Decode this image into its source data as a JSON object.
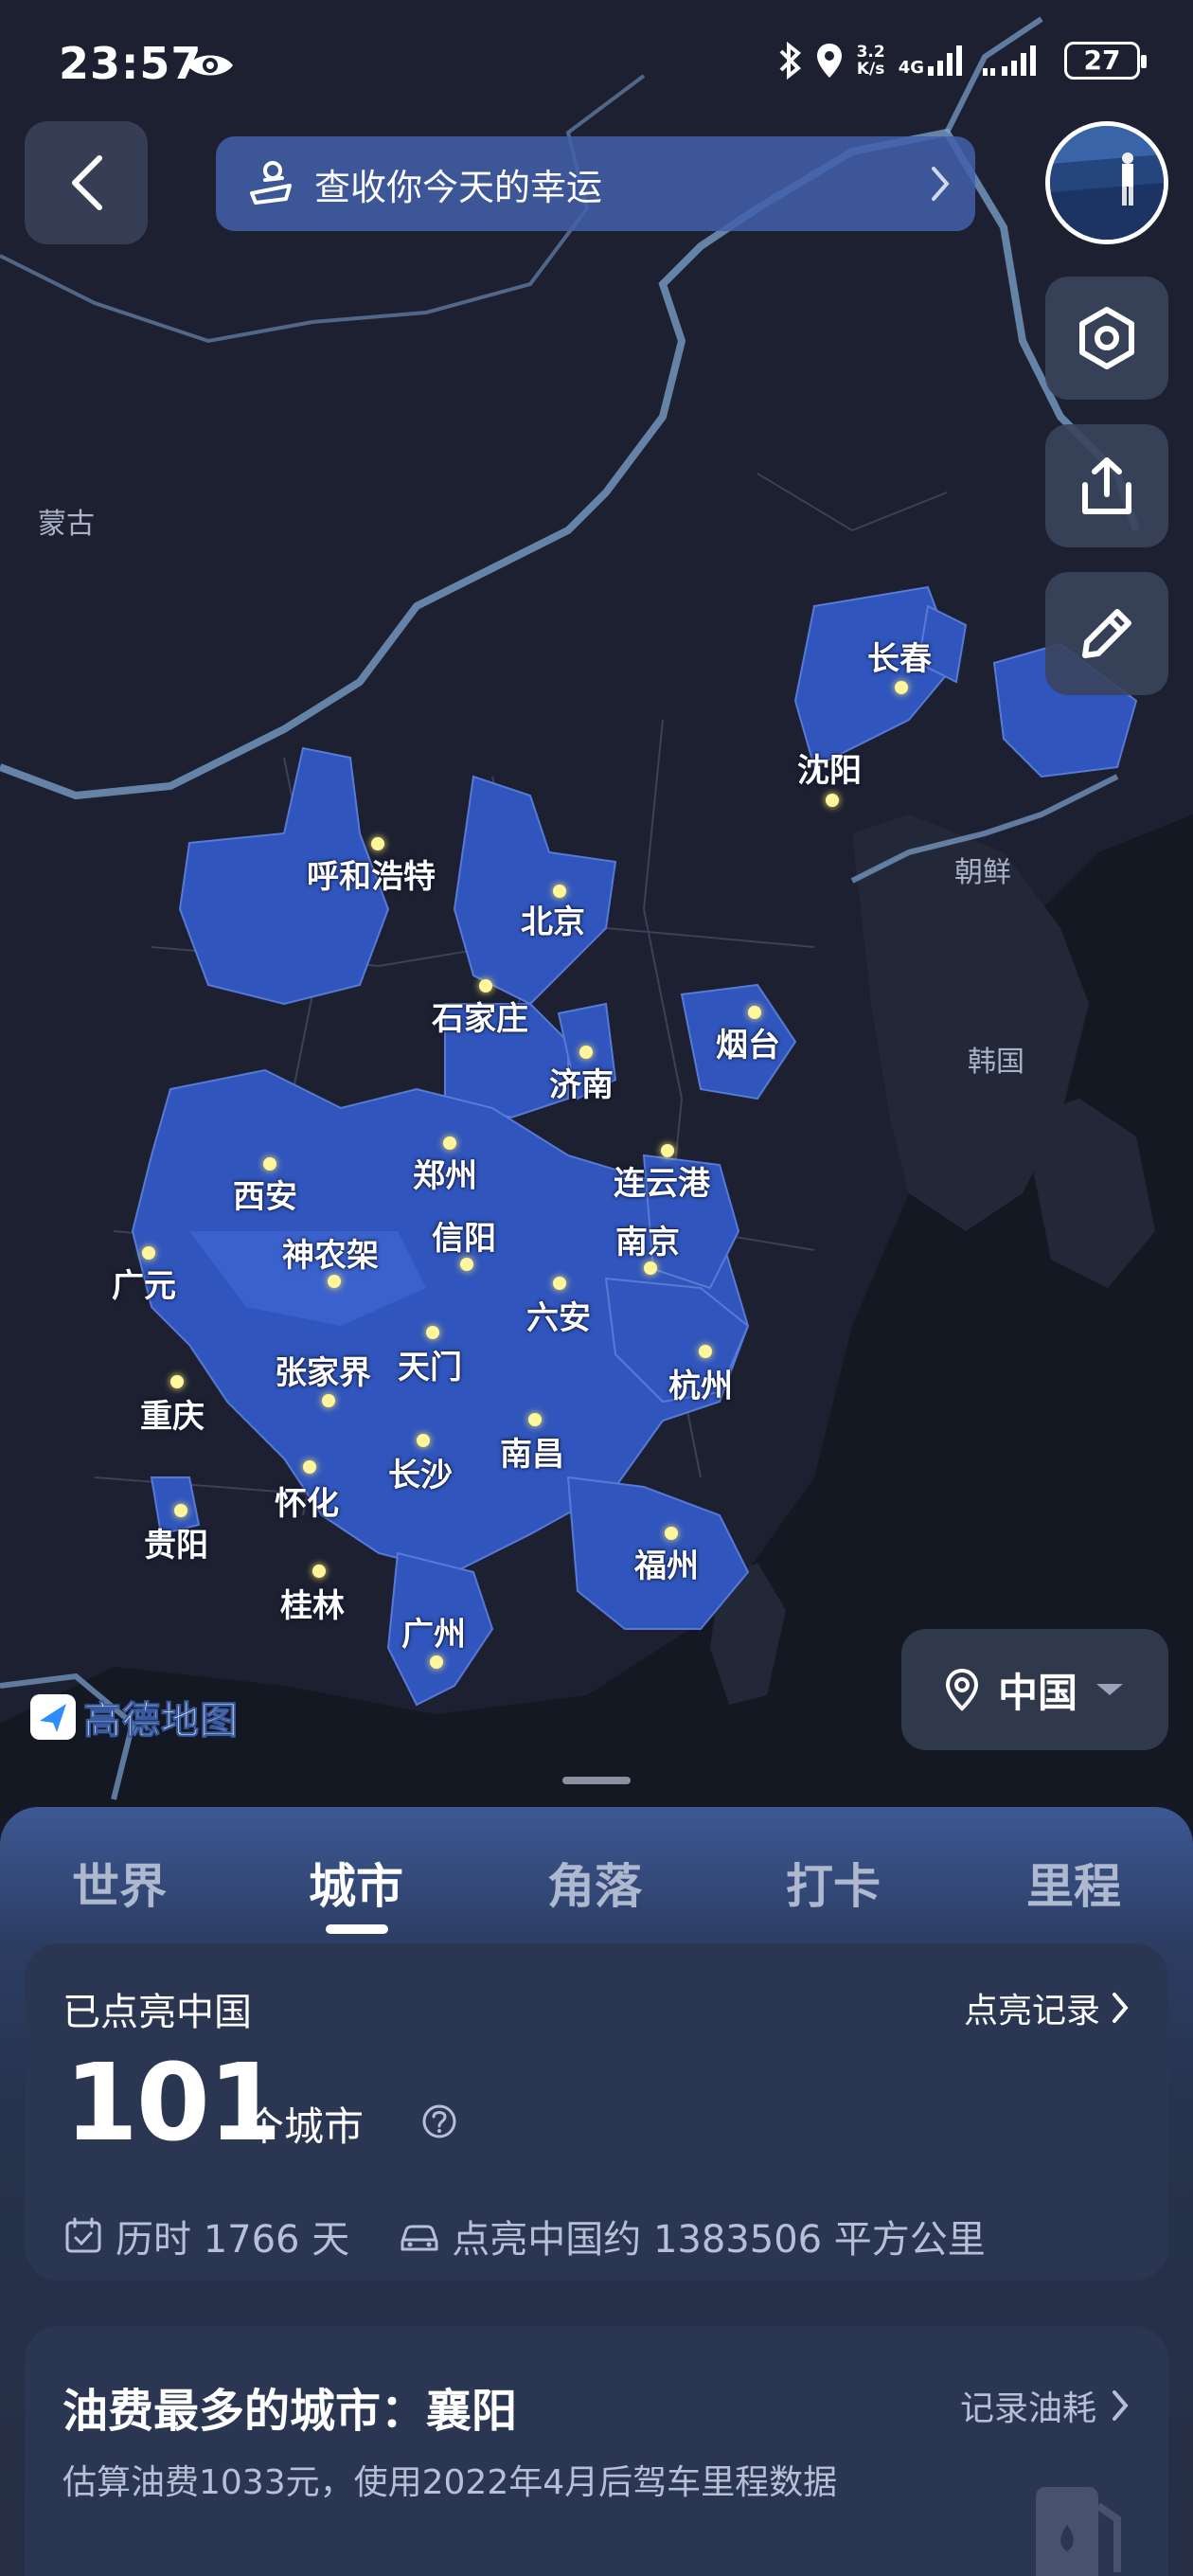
{
  "status_bar": {
    "time": "23:57",
    "speed_value": "3.2",
    "speed_unit": "K/s",
    "network": "4G",
    "battery": "27"
  },
  "header": {
    "fortune_label": "查收你今天的幸运"
  },
  "map": {
    "countries": [
      "蒙古",
      "朝鲜",
      "韩国"
    ],
    "cities": [
      "长春",
      "沈阳",
      "呼和浩特",
      "北京",
      "石家庄",
      "烟台",
      "济南",
      "西安",
      "郑州",
      "连云港",
      "广元",
      "神农架",
      "信阳",
      "南京",
      "六安",
      "张家界",
      "天门",
      "杭州",
      "重庆",
      "南昌",
      "长沙",
      "怀化",
      "贵阳",
      "福州",
      "桂林",
      "广州"
    ],
    "region_selector": "中国",
    "logo": "高德地图",
    "lit_region_color": "#3a5fcb",
    "dot_color": "#fff59a"
  },
  "tabs": [
    {
      "label": "世界",
      "active": false
    },
    {
      "label": "城市",
      "active": true
    },
    {
      "label": "角落",
      "active": false
    },
    {
      "label": "打卡",
      "active": false
    },
    {
      "label": "里程",
      "active": false
    }
  ],
  "summary_card": {
    "title": "已点亮中国",
    "link": "点亮记录",
    "count": "101",
    "unit": "个城市",
    "days_text": "历时 1766 天",
    "area_text": "点亮中国约 1383506 平方公里"
  },
  "fuel_card": {
    "title": "油费最多的城市：襄阳",
    "link": "记录油耗",
    "subtitle": "估算油费1033元，使用2022年4月后驾车里程数据"
  }
}
